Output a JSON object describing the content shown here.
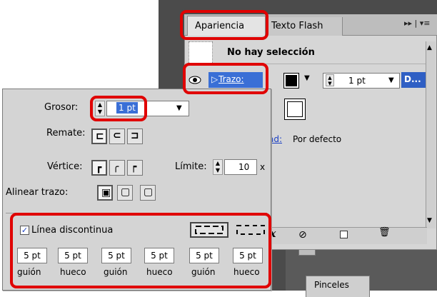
{
  "appearance_panel": {
    "tabs": [
      {
        "label": "Apariencia"
      },
      {
        "label": "Texto Flash"
      }
    ],
    "menu_button": "▸▸ | ▾≡",
    "no_selection": "No hay selección",
    "stroke_row": {
      "label": "Trazo:",
      "weight": "1 pt",
      "truncated": "D..."
    },
    "opacity": {
      "link": "ad:",
      "value": "Por defecto"
    },
    "toolbar": {
      "fx": "fx"
    }
  },
  "stroke_popup": {
    "grosor": {
      "label": "Grosor:",
      "value": "1 pt"
    },
    "remate": {
      "label": "Remate:"
    },
    "vertice": {
      "label": "Vértice:"
    },
    "limite": {
      "label": "Límite:",
      "value": "10",
      "unit": "x"
    },
    "alinear": {
      "label": "Alinear trazo:"
    },
    "dashed": {
      "label": "Línea discontinua",
      "checked": true,
      "values": [
        "5 pt",
        "5 pt",
        "5 pt",
        "5 pt",
        "5 pt",
        "5 pt"
      ],
      "labels": [
        "guión",
        "hueco",
        "guión",
        "hueco",
        "guión",
        "hueco"
      ]
    }
  },
  "background": {
    "pinceles_tab": "Pinceles"
  },
  "colors": {
    "highlight": "#e00000",
    "selection_blue": "#3a6fd6"
  },
  "icons": [
    "eye-icon",
    "fx-icon",
    "clear-appearance-icon",
    "duplicate-item-icon",
    "trash-icon",
    "spinner-icon",
    "dropdown-arrow-icon",
    "checkbox-checked-icon"
  ]
}
